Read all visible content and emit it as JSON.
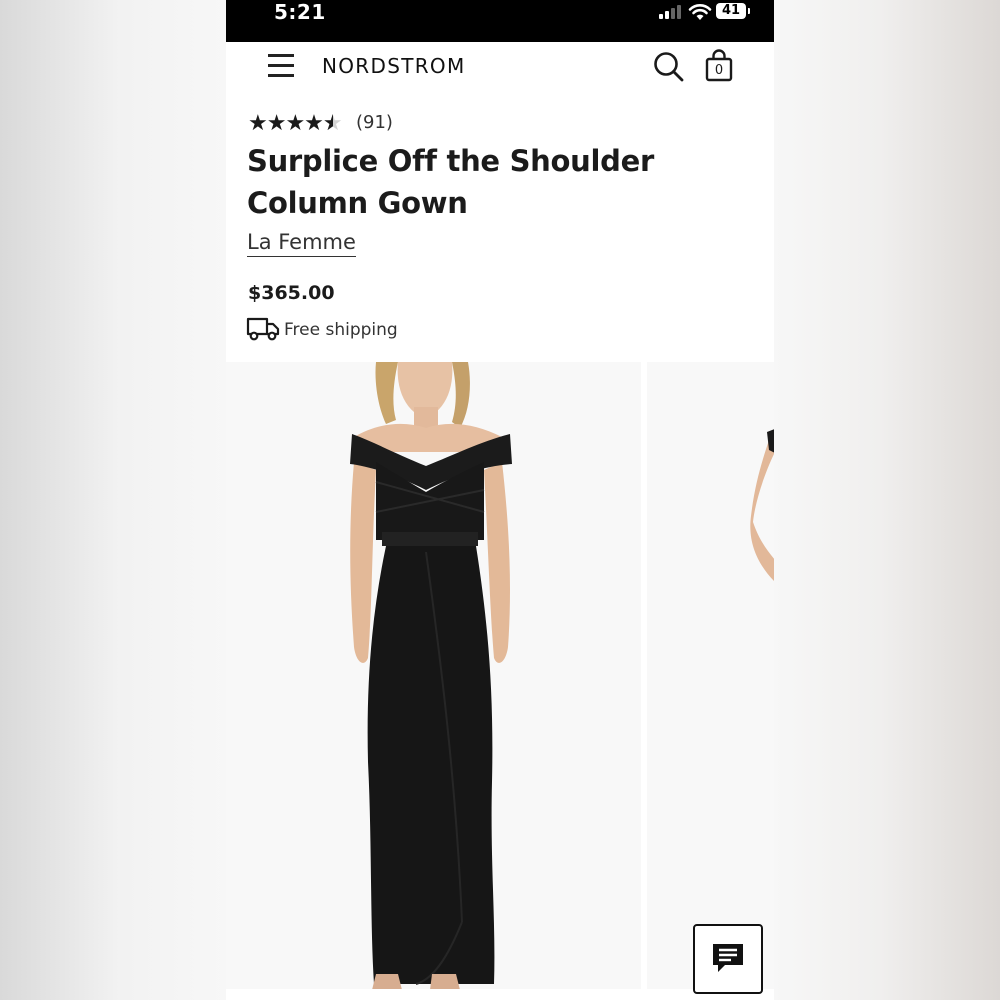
{
  "status_bar": {
    "time": "5:21",
    "battery": "41",
    "icons": [
      "cellular-signal-icon",
      "wifi-icon",
      "battery-icon"
    ]
  },
  "header": {
    "brand": "NORDSTROM",
    "bag_count": "0",
    "icons": [
      "menu-icon",
      "search-icon",
      "shopping-bag-icon"
    ]
  },
  "product": {
    "rating": 4.5,
    "rating_max": 5,
    "review_count": "(91)",
    "title": "Surplice Off the Shoulder Column Gown",
    "brand": "La Femme",
    "price": "$365.00",
    "shipping": "Free shipping"
  },
  "gallery": {
    "images": [
      "main-product-photo",
      "secondary-product-photo"
    ]
  },
  "chat": {
    "icon": "chat-icon"
  },
  "colors": {
    "text": "#1b1b1b",
    "background": "#ffffff",
    "status_bar": "#000000",
    "dress": "#161616"
  }
}
